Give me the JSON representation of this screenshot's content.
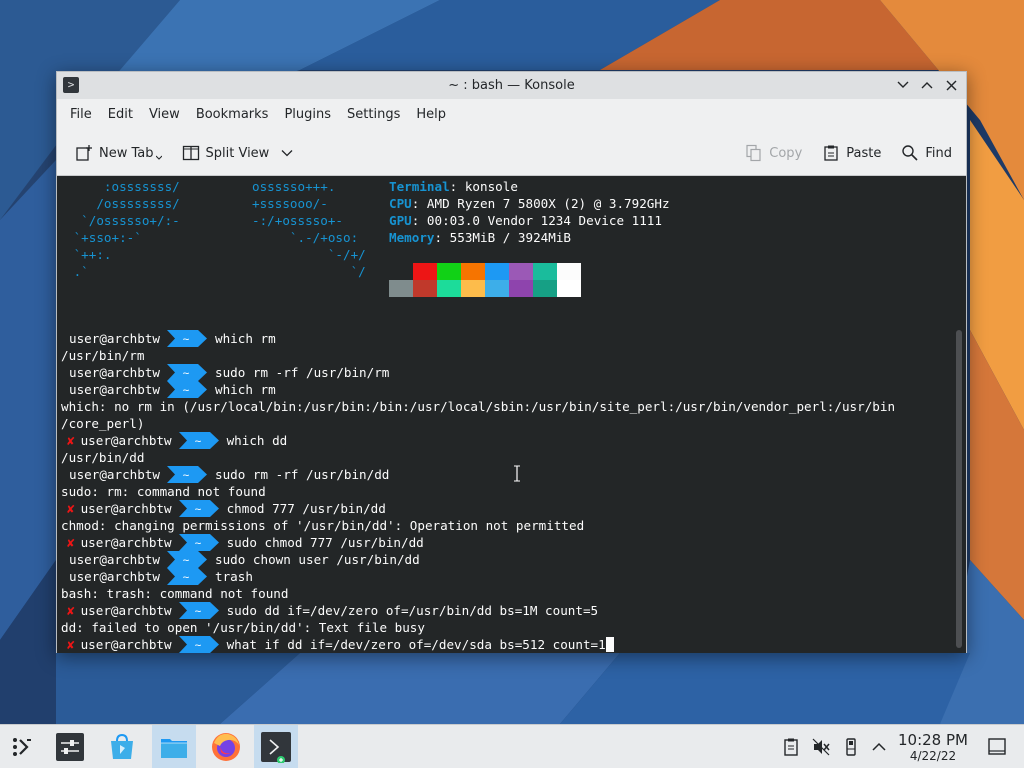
{
  "window": {
    "title": "~ : bash — Konsole",
    "menu": [
      "File",
      "Edit",
      "View",
      "Bookmarks",
      "Plugins",
      "Settings",
      "Help"
    ],
    "toolbar": {
      "new_tab": "New Tab",
      "split_view": "Split View",
      "copy": "Copy",
      "paste": "Paste",
      "find": "Find"
    }
  },
  "neofetch": {
    "logo_left": [
      "     :osssssss/",
      "    /ossssssss/",
      "  `/ossssso+/:-",
      " `+sso+:-`",
      " `++:.",
      " .`"
    ],
    "logo_right": [
      "ossssso+++.",
      "+ssssooo/-",
      "-:/+osssso+-",
      "     `.-/+oso:",
      "          `-/+/",
      "             `/"
    ],
    "info": [
      {
        "key": "Terminal",
        "value": "konsole"
      },
      {
        "key": "CPU",
        "value": "AMD Ryzen 7 5800X (2) @ 3.792GHz"
      },
      {
        "key": "GPU",
        "value": "00:03.0 Vendor 1234 Device 1111"
      },
      {
        "key": "Memory",
        "value": "553MiB / 3924MiB"
      }
    ],
    "palette_top": [
      "#232627",
      "#ed1515",
      "#11d116",
      "#f67400",
      "#1d99f3",
      "#9b59b6",
      "#1abc9c",
      "#fcfcfc"
    ],
    "palette_bottom": [
      "#7f8c8d",
      "#c0392b",
      "#1cdc9a",
      "#fdbc4b",
      "#3daee9",
      "#8e44ad",
      "#16a085",
      "#ffffff"
    ]
  },
  "terminal": {
    "prompt_user": "user@archbtw",
    "prompt_dir": "~",
    "lines": [
      {
        "type": "prompt",
        "error": false,
        "text": "which rm"
      },
      {
        "type": "output",
        "text": "/usr/bin/rm"
      },
      {
        "type": "prompt",
        "error": false,
        "text": "sudo rm -rf /usr/bin/rm"
      },
      {
        "type": "prompt",
        "error": false,
        "text": "which rm"
      },
      {
        "type": "output",
        "text": "which: no rm in (/usr/local/bin:/usr/bin:/bin:/usr/local/sbin:/usr/bin/site_perl:/usr/bin/vendor_perl:/usr/bin"
      },
      {
        "type": "output",
        "text": "/core_perl)"
      },
      {
        "type": "prompt",
        "error": true,
        "text": "which dd"
      },
      {
        "type": "output",
        "text": "/usr/bin/dd"
      },
      {
        "type": "prompt",
        "error": false,
        "text": "sudo rm -rf /usr/bin/dd"
      },
      {
        "type": "output",
        "text": "sudo: rm: command not found"
      },
      {
        "type": "prompt",
        "error": true,
        "text": "chmod 777 /usr/bin/dd"
      },
      {
        "type": "output",
        "text": "chmod: changing permissions of '/usr/bin/dd': Operation not permitted"
      },
      {
        "type": "prompt",
        "error": true,
        "text": "sudo chmod 777 /usr/bin/dd"
      },
      {
        "type": "prompt",
        "error": false,
        "text": "sudo chown user /usr/bin/dd"
      },
      {
        "type": "prompt",
        "error": false,
        "text": "trash"
      },
      {
        "type": "output",
        "text": "bash: trash: command not found"
      },
      {
        "type": "prompt",
        "error": true,
        "text": "sudo dd if=/dev/zero of=/usr/bin/dd bs=1M count=5"
      },
      {
        "type": "output",
        "text": "dd: failed to open '/usr/bin/dd': Text file busy"
      },
      {
        "type": "prompt",
        "error": true,
        "text": "what if dd if=/dev/zero of=/dev/sda bs=512 count=1",
        "cursor": true
      }
    ]
  },
  "taskbar": {
    "items": [
      "application-launcher-icon",
      "system-settings-icon",
      "discover-icon",
      "dolphin-file-manager-icon",
      "firefox-icon",
      "konsole-icon"
    ],
    "clock_time": "10:28 PM",
    "clock_date": "4/22/22"
  },
  "colors": {
    "prompt_arrow": "#1d99f3",
    "error_cross": "#ed1515",
    "accent": "#1793d1"
  }
}
